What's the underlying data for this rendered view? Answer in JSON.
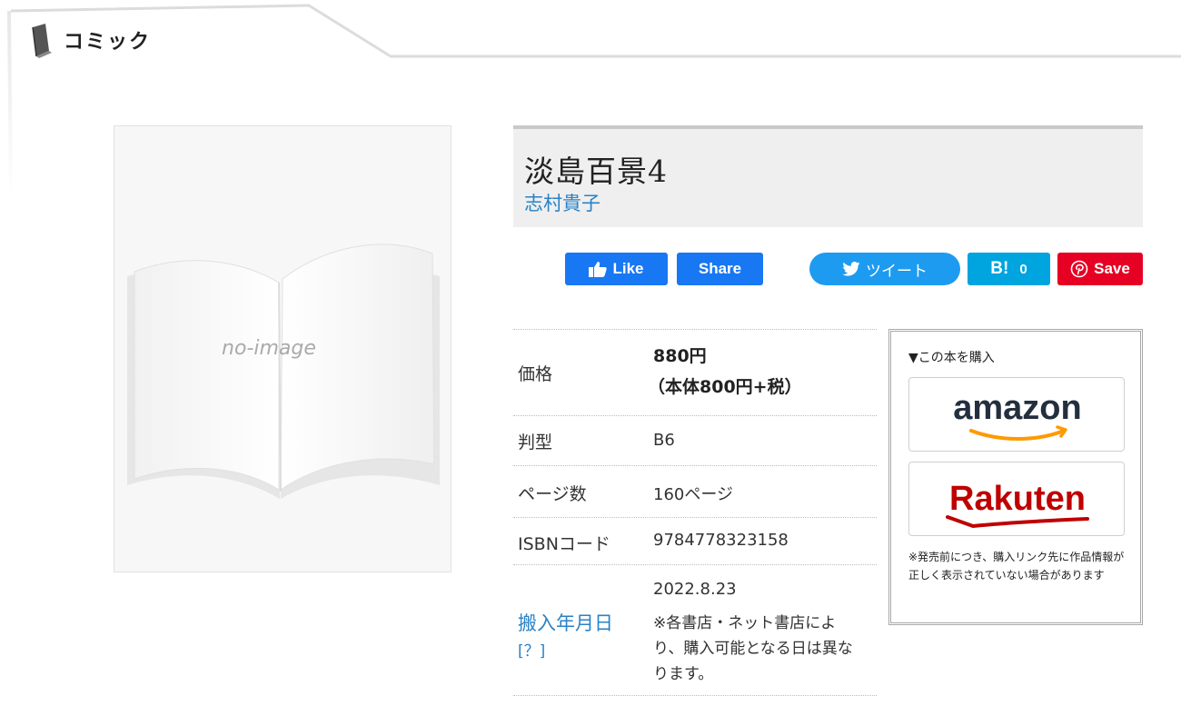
{
  "header": {
    "section_label": "コミック",
    "section_icon": "book-icon"
  },
  "cover": {
    "placeholder_text": "no-image"
  },
  "book": {
    "title": "淡島百景4",
    "author": "志村貴子"
  },
  "social": {
    "like_label": "Like",
    "share_label": "Share",
    "tweet_label": "ツイート",
    "hatena_label": "B!",
    "hatena_count": "0",
    "save_label": "Save"
  },
  "info": {
    "price_label": "価格",
    "price_value": "880円",
    "price_detail": "（本体800円+税）",
    "size_label": "判型",
    "size_value": "B6",
    "pages_label": "ページ数",
    "pages_value": "160ページ",
    "isbn_label": "ISBNコード",
    "isbn_value": "9784778323158",
    "date_label": "搬入年月日",
    "date_help": "[？]",
    "date_value": "2022.8.23",
    "date_note": "※各書店・ネット書店により、購入可能となる日は異なります。"
  },
  "buy": {
    "heading": "▼この本を購入",
    "amazon_logo": "amazon",
    "rakuten_logo": "Rakuten",
    "note": "※発売前につき、購入リンク先に作品情報が正しく表示されていない場合があります"
  },
  "colors": {
    "link": "#2a82c6",
    "facebook": "#1877f2",
    "twitter": "#1d9bf0",
    "hatena": "#00a4de",
    "pinterest": "#e60023",
    "rakuten": "#bf0000",
    "amazon_smile": "#ff9900"
  }
}
